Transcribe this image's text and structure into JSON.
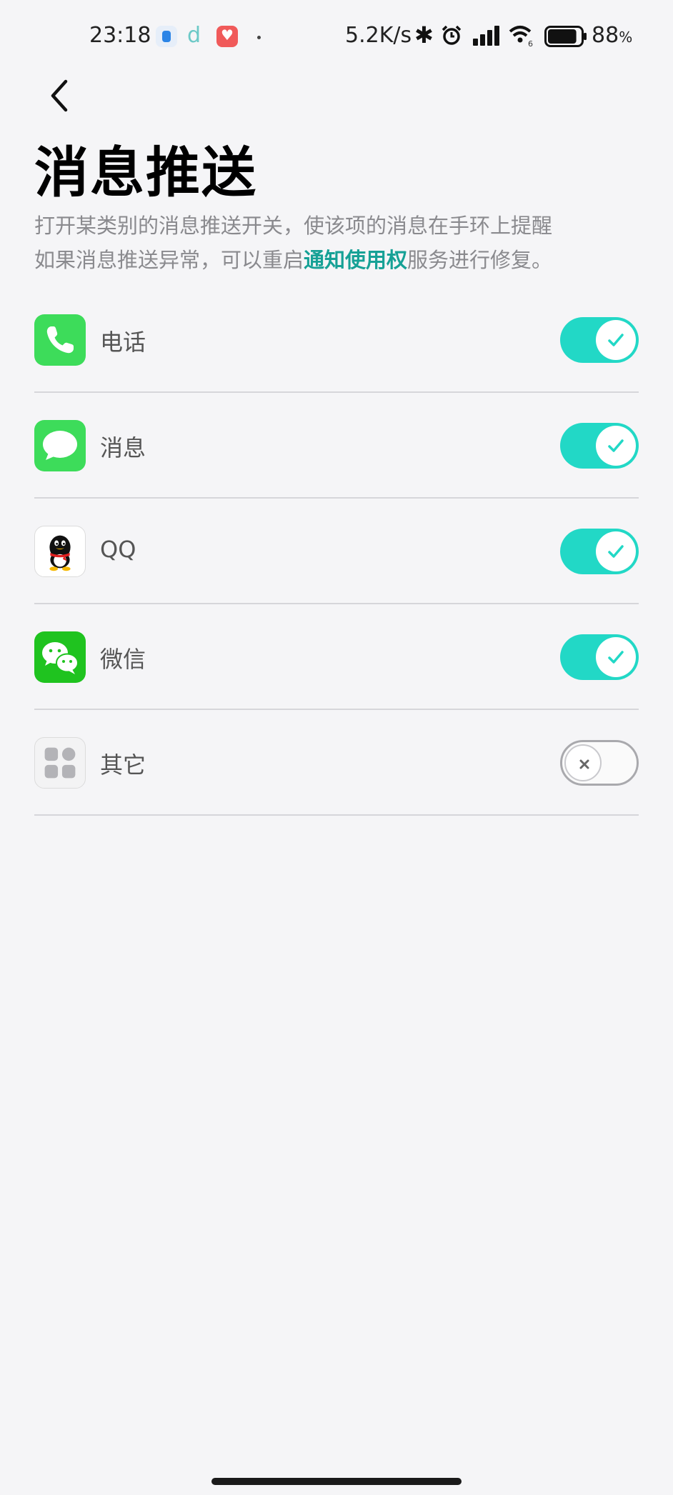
{
  "status_bar": {
    "time": "23:18",
    "app_d_letter": "d",
    "net_speed": "5.2K/s",
    "bluetooth": "✱",
    "battery_number": "88",
    "battery_unit": "%",
    "wifi_sub": "6",
    "battery_level": 0.88
  },
  "header": {
    "title": "消息推送",
    "description_line1": "打开某类别的消息推送开关，使该项的消息在手环上提醒",
    "description_line2_prefix": "如果消息推送异常，可以重启",
    "description_link": "通知使用权",
    "description_line2_suffix": "服务进行修复。"
  },
  "apps": [
    {
      "name": "电话",
      "icon": "phone-app-icon",
      "enabled": true
    },
    {
      "name": "消息",
      "icon": "messages-app-icon",
      "enabled": true
    },
    {
      "name": "QQ",
      "icon": "qq-app-icon",
      "enabled": true
    },
    {
      "name": "微信",
      "icon": "wechat-app-icon",
      "enabled": true
    },
    {
      "name": "其它",
      "icon": "other-apps-icon",
      "enabled": false
    }
  ],
  "colors": {
    "toggle_on": "#22d8c6",
    "link": "#16a196",
    "phone_green": "#3ddc5a",
    "wechat_green": "#1fc31f"
  }
}
